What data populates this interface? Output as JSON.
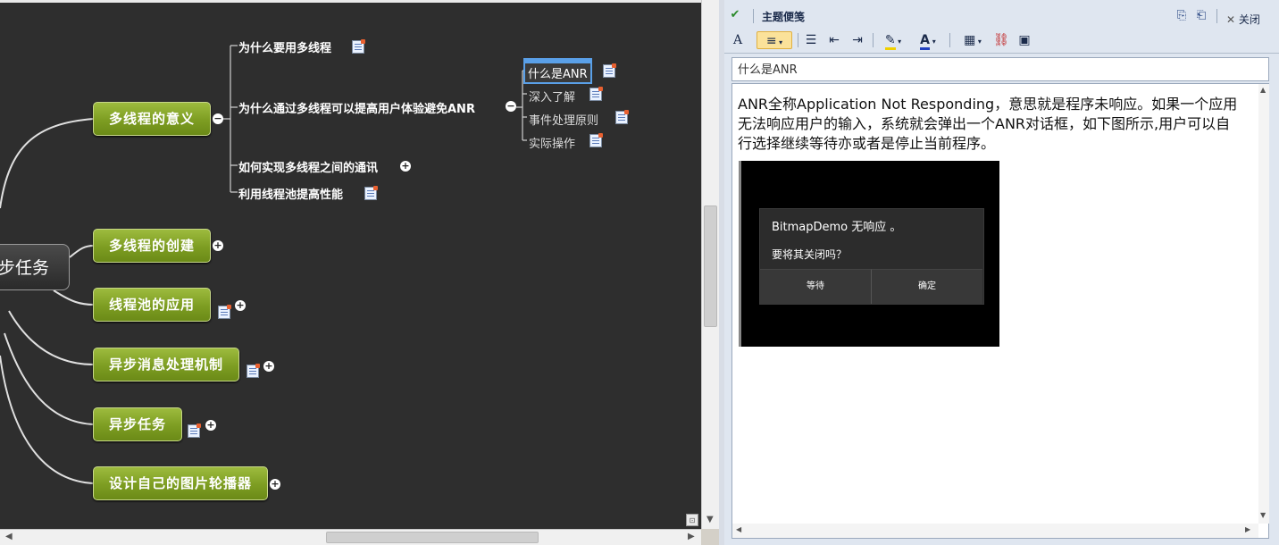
{
  "mindmap": {
    "root": {
      "label": "步任务"
    },
    "branches": [
      {
        "label": "多线程的意义",
        "toggle": "−"
      },
      {
        "label": "多线程的创建",
        "toggle": "+"
      },
      {
        "label": "线程池的应用",
        "toggle": "+"
      },
      {
        "label": "异步消息处理机制",
        "toggle": "+"
      },
      {
        "label": "异步任务",
        "toggle": "+"
      },
      {
        "label": "设计自己的图片轮播器",
        "toggle": "+"
      }
    ],
    "leaves": [
      {
        "label": "为什么要用多线程"
      },
      {
        "label": "为什么通过多线程可以提高用户体验避免ANR",
        "toggle": "−"
      },
      {
        "label": "如何实现多线程之间的通讯",
        "toggle": "+"
      },
      {
        "label": "利用线程池提高性能"
      }
    ],
    "subleaves": [
      {
        "label": "什么是ANR"
      },
      {
        "label": "深入了解"
      },
      {
        "label": "事件处理原则"
      },
      {
        "label": "实际操作"
      }
    ]
  },
  "panel": {
    "title": "主题便笺",
    "close_label": "关闭",
    "toolbar": {
      "font": "A",
      "align": "≡",
      "bullets": "☰",
      "table": "▦"
    },
    "subject": "什么是ANR",
    "body": "ANR全称Application Not Responding，意思就是程序未响应。如果一个应用无法响应用户的输入，系统就会弹出一个ANR对话框，如下图所示,用户可以自行选择继续等待亦或者是停止当前程序。",
    "screenshot": {
      "title": "BitmapDemo 无响应 。",
      "message": "要将其关闭吗？",
      "wait": "等待",
      "ok": "确定"
    }
  }
}
